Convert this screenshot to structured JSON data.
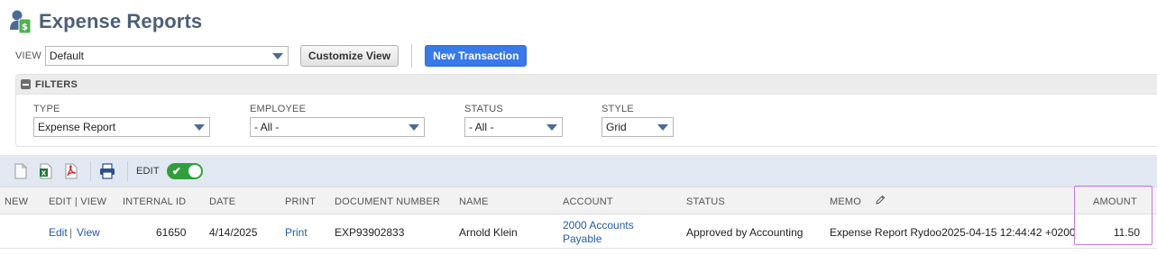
{
  "page": {
    "title": "Expense Reports"
  },
  "view": {
    "label": "VIEW",
    "selected": "Default",
    "customize_label": "Customize View",
    "new_transaction_label": "New Transaction"
  },
  "filters": {
    "title": "FILTERS",
    "type": {
      "label": "TYPE",
      "value": "Expense Report"
    },
    "employee": {
      "label": "EMPLOYEE",
      "value": "- All -"
    },
    "status": {
      "label": "STATUS",
      "value": "- All -"
    },
    "style": {
      "label": "STYLE",
      "value": "Grid"
    }
  },
  "toolbar": {
    "icons": [
      "new-document-icon",
      "excel-export-icon",
      "pdf-export-icon",
      "print-icon"
    ],
    "edit_label": "EDIT",
    "edit_toggle_on": true,
    "toggle_color": "#2f9f3b"
  },
  "table": {
    "columns": [
      "NEW",
      "EDIT | VIEW",
      "INTERNAL ID",
      "DATE",
      "PRINT",
      "DOCUMENT NUMBER",
      "NAME",
      "ACCOUNT",
      "STATUS",
      "MEMO",
      "AMOUNT"
    ],
    "rows": [
      {
        "edit": "Edit",
        "separator": "|",
        "view": "View",
        "internal_id": "61650",
        "date": "4/14/2025",
        "print": "Print",
        "document_number": "EXP93902833",
        "name": "Arnold Klein",
        "account_line1": "2000 Accounts",
        "account_line2": "Payable",
        "status": "Approved by Accounting",
        "memo": "Expense Report Rydoo2025-04-15 12:44:42 +0200",
        "amount": "11.50"
      }
    ]
  },
  "colors": {
    "title": "#4d5f79",
    "primary_button": "#3a7ae8",
    "link": "#255ba6",
    "toolbar_bg": "#e2e8f1",
    "highlight": "#c47be8"
  }
}
